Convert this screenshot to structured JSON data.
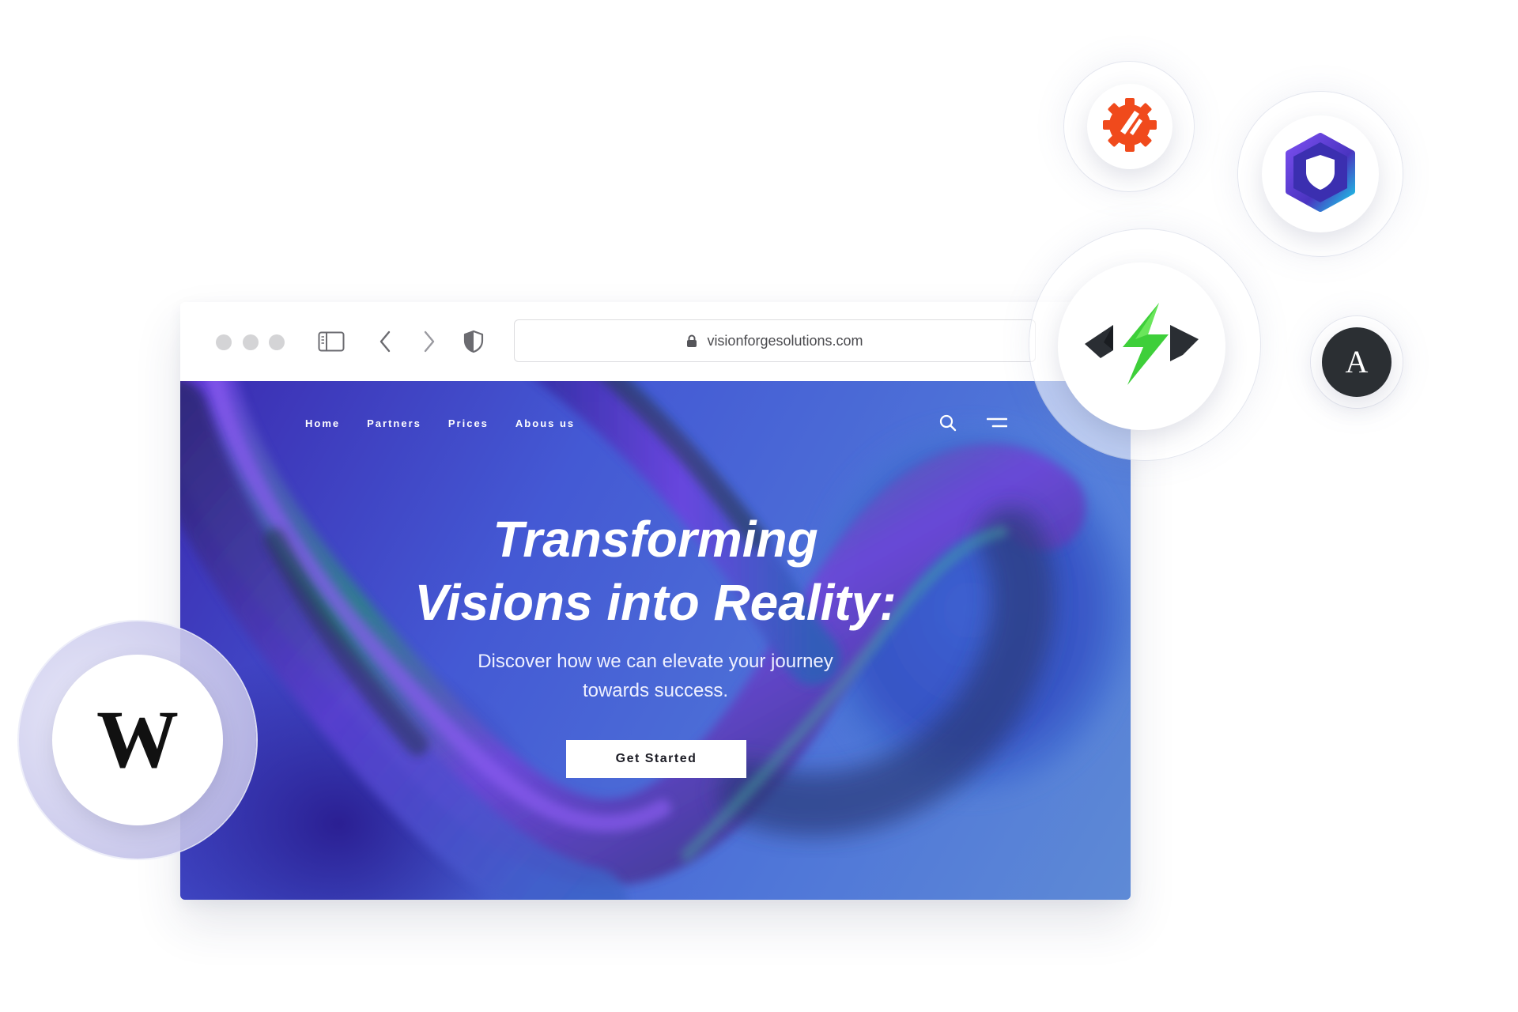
{
  "browser": {
    "url": "visionforgesolutions.com",
    "icons": [
      "window-dot-icon",
      "sidebar-icon",
      "back-arrow-icon",
      "forward-arrow-icon",
      "shield-icon",
      "lock-icon"
    ]
  },
  "site": {
    "nav": {
      "items": [
        {
          "label": "Home"
        },
        {
          "label": "Partners"
        },
        {
          "label": "Prices"
        },
        {
          "label": "Abous us"
        }
      ],
      "icons": [
        "search-icon",
        "menu-icon"
      ]
    },
    "hero": {
      "title_line1": "Transforming",
      "title_line2": "Visions into Reality:",
      "subtitle_line1": "Discover how we can elevate your journey",
      "subtitle_line2": "towards success.",
      "cta_label": "Get Started"
    }
  },
  "badges": [
    {
      "name": "gear-logo-icon",
      "color": "#f04a1c"
    },
    {
      "name": "hexagon-shield-logo-icon",
      "color": "#5a3fc8"
    },
    {
      "name": "lightning-code-logo-icon",
      "color": "#3ecf3a"
    },
    {
      "name": "a-logo-icon",
      "text": "A",
      "color": "#2b2f33"
    },
    {
      "name": "w-logo-icon",
      "text": "W",
      "color": "#111111"
    }
  ],
  "colors": {
    "hero_gradient_start": "#3b2bb0",
    "hero_gradient_end": "#5e8ad6",
    "cta_background": "#ffffff"
  }
}
